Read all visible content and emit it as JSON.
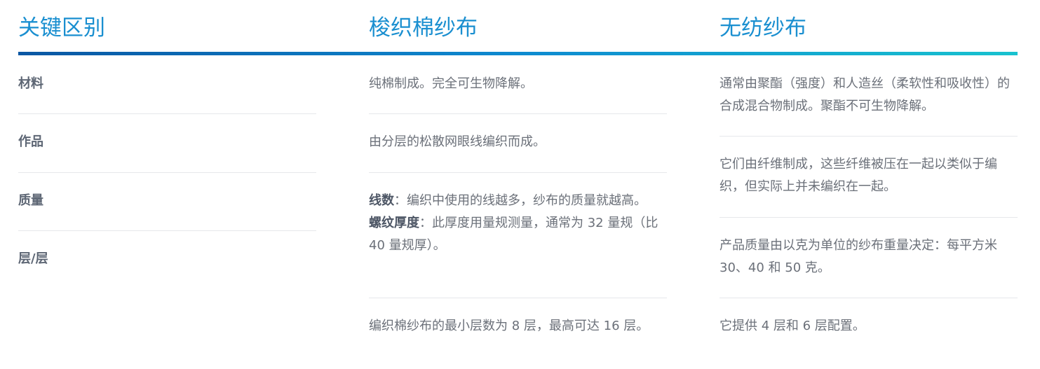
{
  "headers": [
    "关键区别",
    "梭织棉纱布",
    "无纺纱布"
  ],
  "rows": [
    {
      "key": "材料",
      "woven": "纯棉制成。完全可生物降解。",
      "nonwoven": "通常由聚酯（强度）和人造丝（柔软性和吸收性）的合成混合物制成。聚酯不可生物降解。"
    },
    {
      "key": "作品",
      "woven": "由分层的松散网眼线编织而成。",
      "nonwoven": "它们由纤维制成，这些纤维被压在一起以类似于编织，但实际上并未编织在一起。"
    },
    {
      "key": "质量",
      "woven_parts": [
        {
          "term": "线数",
          "text": "：编织中使用的线越多，纱布的质量就越高。"
        },
        {
          "term": "螺纹厚度",
          "text": "：此厚度用量规测量，通常为 32 量规（比 40 量规厚）。"
        }
      ],
      "nonwoven": "产品质量由以克为单位的纱布重量决定：每平方米 30、40 和 50 克。"
    },
    {
      "key": "层/层",
      "woven": "编织棉纱布的最小层数为 8 层，最高可达 16 层。",
      "nonwoven": "它提供 4 层和 6 层配置。"
    }
  ]
}
